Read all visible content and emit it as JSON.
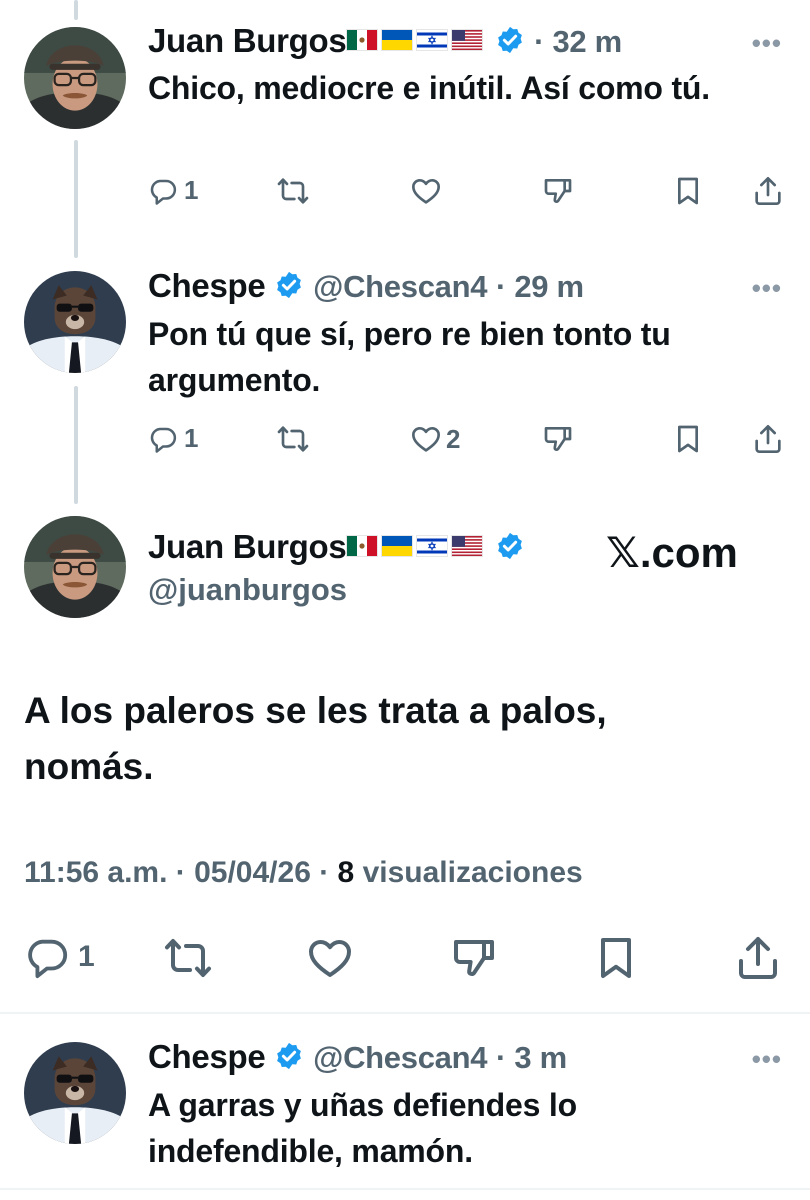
{
  "tweets": [
    {
      "name": "Juan Burgos",
      "handle": "",
      "time": "· 32 m",
      "text": "Chico, mediocre e inútil. Así como tú.",
      "replies": "1",
      "retweets": "",
      "likes": ""
    },
    {
      "name": "Chespe",
      "handle": "@Chescan4",
      "time": "· 29 m",
      "text": "Pon tú que sí, pero re bien tonto tu argumento.",
      "replies": "1",
      "retweets": "",
      "likes": "2"
    },
    {
      "name": "Chespe",
      "handle": "@Chescan4",
      "time": "· 3 m",
      "text": "A garras y uñas defiendes lo indefendible, mamón.",
      "replies": "",
      "retweets": "",
      "likes": ""
    }
  ],
  "main_tweet": {
    "name": "Juan Burgos",
    "handle": "@juanburgos",
    "text": "A los paleros se les trata a palos, nomás.",
    "time": "11:56 a.m. · 05/04/26 ·",
    "views_count": "8",
    "views_label": "visualizaciones",
    "replies": "1"
  },
  "watermark": "𝕏.com",
  "icons": [
    "reply-icon",
    "retweet-icon",
    "like-icon",
    "dislike-icon",
    "bookmark-icon",
    "share-icon",
    "verified-icon",
    "more-icon"
  ],
  "colors": {
    "verified": "#1d9bf0",
    "muted": "#536471",
    "text": "#0f1419",
    "thread": "#cfd9de"
  }
}
